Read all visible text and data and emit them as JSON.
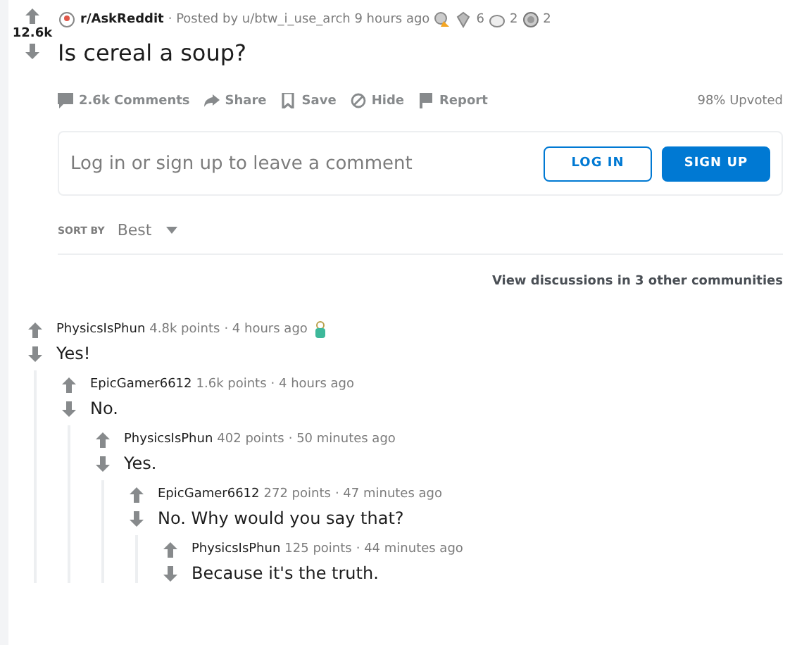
{
  "post": {
    "score": "12.6k",
    "subreddit": "r/AskReddit",
    "posted_by": "· Posted by u/btw_i_use_arch 9 hours ago",
    "awards": [
      {
        "kind": "trophy"
      },
      {
        "kind": "gem",
        "count": "6"
      },
      {
        "kind": "face",
        "count": "2"
      },
      {
        "kind": "coin",
        "count": "2"
      }
    ],
    "title": "Is cereal a soup?",
    "actions": [
      {
        "kind": "comment",
        "label": "2.6k Comments"
      },
      {
        "kind": "share",
        "label": "Share"
      },
      {
        "kind": "save",
        "label": "Save"
      },
      {
        "kind": "hide",
        "label": "Hide"
      },
      {
        "kind": "report",
        "label": "Report"
      }
    ],
    "upvoted": "98% Upvoted"
  },
  "comment_box": {
    "placeholder": "Log in or sign up to leave a comment",
    "buttons": [
      {
        "kind": "outline",
        "label": "LOG IN"
      },
      {
        "kind": "solid",
        "label": "SIGN UP"
      }
    ]
  },
  "sort": {
    "label": "SORT BY",
    "value": "Best"
  },
  "other_discussions": "View discussions in 3 other communities",
  "comments": [
    {
      "author": "PhysicsIsPhun",
      "points": "4.8k points",
      "time": "· 4 hours ago",
      "award": true,
      "text": "Yes!",
      "children": [
        {
          "author": "EpicGamer6612",
          "points": "1.6k points",
          "time": "· 4 hours ago",
          "award": false,
          "text": "No.",
          "children": [
            {
              "author": "PhysicsIsPhun",
              "points": "402 points",
              "time": "· 50 minutes ago",
              "award": false,
              "text": "Yes.",
              "children": [
                {
                  "author": "EpicGamer6612",
                  "points": "272 points",
                  "time": "· 47 minutes ago",
                  "award": false,
                  "text": "No. Why would you say that?",
                  "children": [
                    {
                      "author": "PhysicsIsPhun",
                      "points": "125 points",
                      "time": "· 44 minutes ago",
                      "award": false,
                      "text": "Because it's the truth."
                    }
                  ]
                }
              ]
            }
          ]
        }
      ]
    }
  ]
}
